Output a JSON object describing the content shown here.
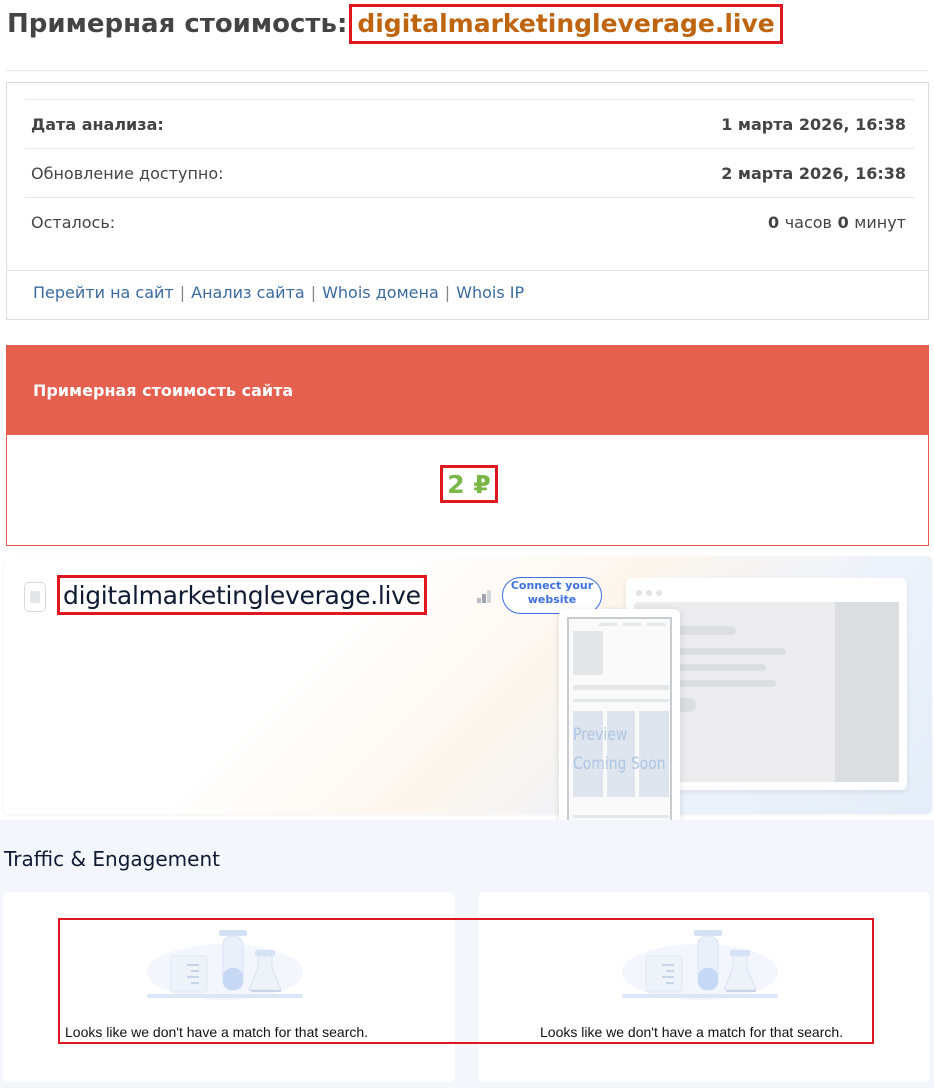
{
  "header": {
    "title_prefix": "Примерная стоимость:",
    "domain": "digitalmarketingleverage.live"
  },
  "analysis": {
    "rows": [
      {
        "label": "Дата анализа:",
        "value": "1 марта 2026, 16:38"
      },
      {
        "label": "Обновление доступно:",
        "value": "2 марта 2026, 16:38"
      }
    ],
    "remaining": {
      "label": "Осталось:",
      "hours": "0",
      "hours_unit": "часов",
      "minutes": "0",
      "minutes_unit": "минут"
    },
    "links": [
      "Перейти на сайт",
      "Анализ сайта",
      "Whois домена",
      "Whois IP"
    ],
    "link_separator": "|"
  },
  "valuation": {
    "header": "Примерная стоимость сайта",
    "amount": "2 ₽",
    "amount_color": "#7ab648",
    "header_color": "#e5604f"
  },
  "site_card": {
    "domain": "digitalmarketingleverage.live",
    "connect_button": "Connect your website",
    "preview_line1": "Preview",
    "preview_line2": "Coming Soon",
    "icons": {
      "favicon": "page-icon",
      "rank": "bar-chart-icon"
    }
  },
  "traffic": {
    "title": "Traffic & Engagement",
    "cards": [
      {
        "message": "Looks like we don't have a match for that search.",
        "icon": "lab-flasks-icon"
      },
      {
        "message": "Looks like we don't have a match for that search.",
        "icon": "lab-flasks-icon"
      }
    ]
  },
  "accent_colors": {
    "highlight": "#e0171f",
    "domain_orange": "#c0650f",
    "link_blue": "#3a6aa0",
    "brand_blue": "#3d6fe0"
  }
}
